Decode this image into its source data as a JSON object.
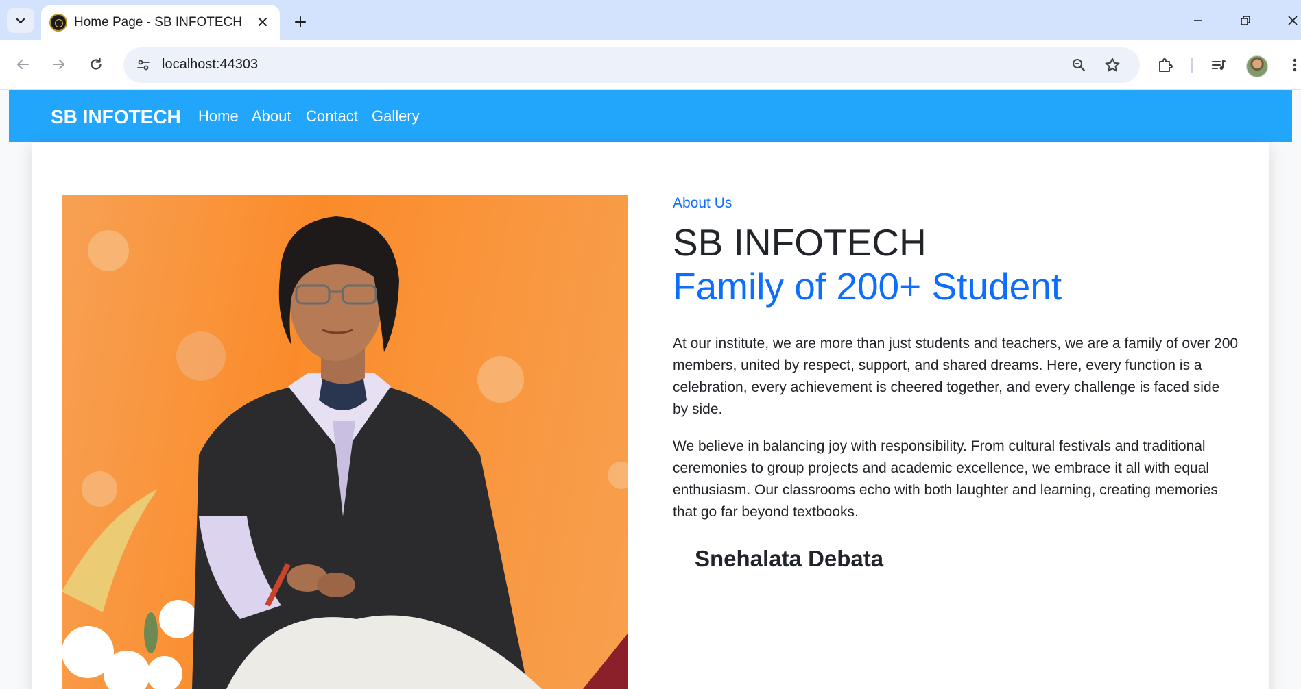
{
  "browser": {
    "tab_title": "Home Page - SB INFOTECH",
    "url": "localhost:44303",
    "icons": [
      "tab-list-chevron-icon",
      "close-icon",
      "plus-icon",
      "minimize-icon",
      "restore-icon",
      "window-close-icon",
      "back-arrow-icon",
      "forward-arrow-icon",
      "reload-icon",
      "site-settings-icon",
      "zoom-icon",
      "bookmark-star-icon",
      "extensions-icon",
      "media-queue-icon",
      "profile-avatar",
      "kebab-menu-icon"
    ]
  },
  "site": {
    "brand": "SB INFOTECH",
    "nav": [
      "Home",
      "About",
      "Contact",
      "Gallery"
    ],
    "colors": {
      "navbar": "#22a6fb",
      "accent": "#0d6efd",
      "text": "#212529"
    }
  },
  "about": {
    "label": "About Us",
    "title": "SB INFOTECH",
    "subtitle": "Family of 200+ Student",
    "paragraphs": [
      "At our institute, we are more than just students and teachers, we are a family of over 200 members, united by respect, support, and shared dreams. Here, every function is a celebration, every achievement is cheered together, and every challenge is faced side by side.",
      "We believe in balancing joy with responsibility. From cultural festivals and traditional ceremonies to group projects and academic excellence, we embrace it all with equal enthusiasm. Our classrooms echo with both laughter and learning, creating memories that go far beyond textbooks."
    ],
    "person_name": "Snehalata Debata"
  }
}
